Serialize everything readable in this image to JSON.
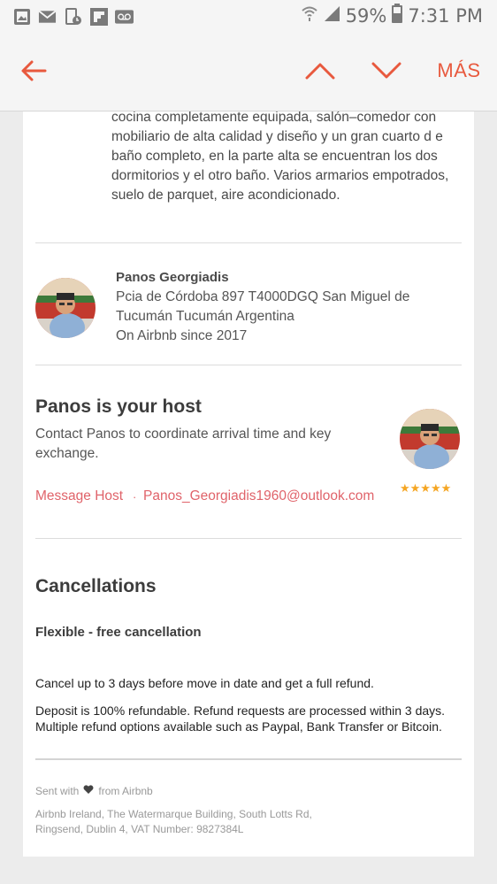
{
  "status_bar": {
    "battery": "59%",
    "time": "7:31 PM"
  },
  "app_bar": {
    "more_label": "MÁS"
  },
  "listing": {
    "description_lines": [
      "cocina completamente equipada, salón–comedor con",
      "mobiliario de alta calidad y diseño y un gran cuarto d e",
      "baño completo, en la parte alta se encuentran los dos",
      "dormitorios y el otro baño. Varios armarios empotrados,",
      "suelo de parquet, aire acondicionado."
    ]
  },
  "owner": {
    "name": "Panos Georgiadis",
    "address_line1": "Pcia de Córdoba 897 T4000DGQ San Miguel de",
    "address_line2": "Tucumán Tucumán Argentina",
    "since": "On Airbnb since 2017"
  },
  "host": {
    "title": "Panos is your host",
    "description": "Contact Panos to coordinate arrival time and key exchange.",
    "message_link": "Message Host",
    "separator": "·",
    "email_link": "Panos_Georgiadis1960@outlook.com",
    "stars": "★★★★★",
    "rating": 5
  },
  "cancellations": {
    "title": "Cancellations",
    "policy": "Flexible - free cancellation",
    "para1": "Cancel up to 3 days before move in date and get a full refund.",
    "para2_line1": "Deposit is 100% refundable. Refund requests are processed within 3 days.",
    "para2_line2": "Multiple refund options available such as Paypal, Bank Transfer or Bitcoin."
  },
  "footer": {
    "sent_with_prefix": "Sent with",
    "sent_with_suffix": "from Airbnb",
    "address_line1": "Airbnb Ireland, The Watermarque Building, South Lotts Rd,",
    "address_line2": "Ringsend, Dublin 4, VAT Number: 9827384L"
  },
  "colors": {
    "accent": "#e8593e",
    "link": "#e0636a",
    "star": "#f5a623"
  }
}
